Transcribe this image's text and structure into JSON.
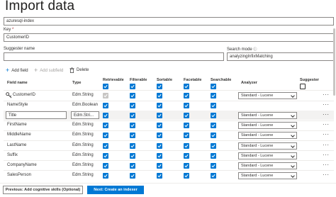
{
  "page_title": "Import data",
  "index_name": {
    "value": "azuresql-index"
  },
  "key": {
    "label": "Key",
    "required_mark": "*",
    "value": "CustomerID"
  },
  "suggester": {
    "label": "Suggester name",
    "value": ""
  },
  "search_mode": {
    "label": "Search mode",
    "required_mark": "ⓘ",
    "value": "analyzingInfixMatching"
  },
  "toolbar": {
    "add_field": "Add field",
    "add_subfield": "Add subfield",
    "delete": "Delete"
  },
  "columns": {
    "field_name": "Field name",
    "type": "Type",
    "retrievable": "Retrievable",
    "filterable": "Filterable",
    "sortable": "Sortable",
    "facetable": "Facetable",
    "searchable": "Searchable",
    "analyzer": "Analyzer",
    "suggester": "Suggester"
  },
  "rows": [
    {
      "name": "CustomerID",
      "type": "Edm.String",
      "analyzer": "Standard - Lucene",
      "key": true
    },
    {
      "name": "NameStyle",
      "type": "Edm.Boolean",
      "analyzer": ""
    },
    {
      "name": "Title",
      "type": "Edm.Stri...",
      "analyzer": "Standard - Lucene",
      "editing": true
    },
    {
      "name": "FirstName",
      "type": "Edm.String",
      "analyzer": "Standard - Lucene"
    },
    {
      "name": "MiddleName",
      "type": "Edm.String",
      "analyzer": "Standard - Lucene"
    },
    {
      "name": "LastName",
      "type": "Edm.String",
      "analyzer": "Standard - Lucene"
    },
    {
      "name": "Suffix",
      "type": "Edm.String",
      "analyzer": "Standard - Lucene"
    },
    {
      "name": "CompanyName",
      "type": "Edm.String",
      "analyzer": "Standard - Lucene"
    },
    {
      "name": "SalesPerson",
      "type": "Edm.String",
      "analyzer": "Standard - Lucene"
    }
  ],
  "more_label": "···",
  "footer": {
    "previous": "Previous: Add cognitive skills (Optional)",
    "next": "Next: Create an indexer"
  },
  "colors": {
    "accent": "#0078d4",
    "disabled": "#c8c6c4"
  },
  "icons": {
    "add": "plus-icon",
    "delete": "trash-icon",
    "key": "key-icon",
    "more": "more-icon",
    "dropdown": "chevron-down-icon"
  }
}
